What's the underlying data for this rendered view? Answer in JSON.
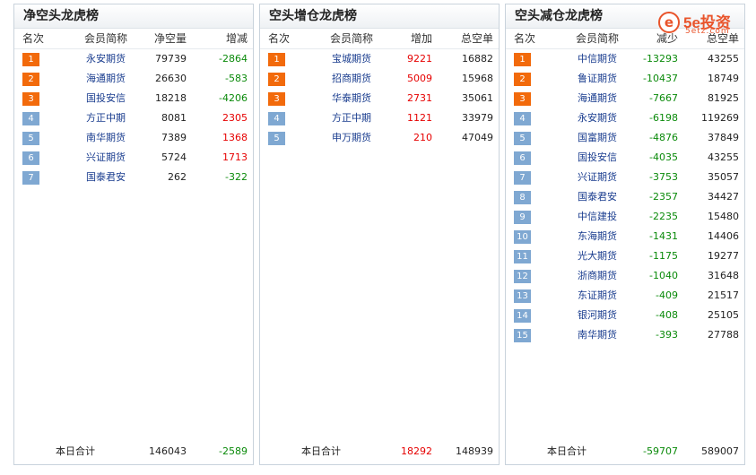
{
  "logo": {
    "text": "5e投资",
    "sub": "5etz.com"
  },
  "panels": [
    {
      "title": "净空头龙虎榜",
      "headers": [
        "名次",
        "会员简称",
        "净空量",
        "增减"
      ],
      "rows": [
        {
          "rank": "1",
          "name": "永安期货",
          "v1": "79739",
          "v2": "-2864",
          "v2c": "green"
        },
        {
          "rank": "2",
          "name": "海通期货",
          "v1": "26630",
          "v2": "-583",
          "v2c": "green"
        },
        {
          "rank": "3",
          "name": "国投安信",
          "v1": "18218",
          "v2": "-4206",
          "v2c": "green"
        },
        {
          "rank": "4",
          "name": "方正中期",
          "v1": "8081",
          "v2": "2305",
          "v2c": "red"
        },
        {
          "rank": "5",
          "name": "南华期货",
          "v1": "7389",
          "v2": "1368",
          "v2c": "red"
        },
        {
          "rank": "6",
          "name": "兴证期货",
          "v1": "5724",
          "v2": "1713",
          "v2c": "red"
        },
        {
          "rank": "7",
          "name": "国泰君安",
          "v1": "262",
          "v2": "-322",
          "v2c": "green"
        }
      ],
      "footer": {
        "label": "本日合计",
        "v1": "146043",
        "v1c": "black",
        "v2": "-2589",
        "v2c": "green"
      }
    },
    {
      "title": "空头增仓龙虎榜",
      "headers": [
        "名次",
        "会员简称",
        "增加",
        "总空单"
      ],
      "rows": [
        {
          "rank": "1",
          "name": "宝城期货",
          "v1": "9221",
          "v2": "16882"
        },
        {
          "rank": "2",
          "name": "招商期货",
          "v1": "5009",
          "v2": "15968"
        },
        {
          "rank": "3",
          "name": "华泰期货",
          "v1": "2731",
          "v2": "35061"
        },
        {
          "rank": "4",
          "name": "方正中期",
          "v1": "1121",
          "v2": "33979"
        },
        {
          "rank": "5",
          "name": "申万期货",
          "v1": "210",
          "v2": "47049"
        }
      ],
      "v1c": "red",
      "footer": {
        "label": "本日合计",
        "v1": "18292",
        "v1c": "red",
        "v2": "148939",
        "v2c": "black"
      }
    },
    {
      "title": "空头减仓龙虎榜",
      "headers": [
        "名次",
        "会员简称",
        "减少",
        "总空单"
      ],
      "rows": [
        {
          "rank": "1",
          "name": "中信期货",
          "v1": "-13293",
          "v2": "43255"
        },
        {
          "rank": "2",
          "name": "鲁证期货",
          "v1": "-10437",
          "v2": "18749"
        },
        {
          "rank": "3",
          "name": "海通期货",
          "v1": "-7667",
          "v2": "81925"
        },
        {
          "rank": "4",
          "name": "永安期货",
          "v1": "-6198",
          "v2": "119269"
        },
        {
          "rank": "5",
          "name": "国富期货",
          "v1": "-4876",
          "v2": "37849"
        },
        {
          "rank": "6",
          "name": "国投安信",
          "v1": "-4035",
          "v2": "43255"
        },
        {
          "rank": "7",
          "name": "兴证期货",
          "v1": "-3753",
          "v2": "35057"
        },
        {
          "rank": "8",
          "name": "国泰君安",
          "v1": "-2357",
          "v2": "34427"
        },
        {
          "rank": "9",
          "name": "中信建投",
          "v1": "-2235",
          "v2": "15480"
        },
        {
          "rank": "10",
          "name": "东海期货",
          "v1": "-1431",
          "v2": "14406"
        },
        {
          "rank": "11",
          "name": "光大期货",
          "v1": "-1175",
          "v2": "19277"
        },
        {
          "rank": "12",
          "name": "浙商期货",
          "v1": "-1040",
          "v2": "31648"
        },
        {
          "rank": "13",
          "name": "东证期货",
          "v1": "-409",
          "v2": "21517"
        },
        {
          "rank": "14",
          "name": "银河期货",
          "v1": "-408",
          "v2": "25105"
        },
        {
          "rank": "15",
          "name": "南华期货",
          "v1": "-393",
          "v2": "27788"
        }
      ],
      "v1c": "green",
      "footer": {
        "label": "本日合计",
        "v1": "-59707",
        "v1c": "green",
        "v2": "589007",
        "v2c": "black"
      }
    }
  ]
}
